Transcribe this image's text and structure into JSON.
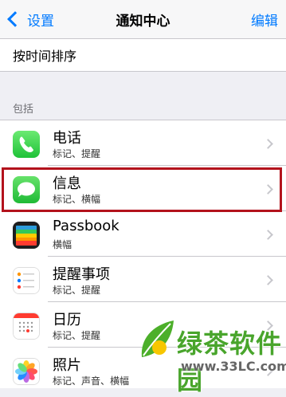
{
  "navbar": {
    "back_label": "设置",
    "title": "通知中心",
    "edit_label": "编辑"
  },
  "sort": {
    "label": "按时间排序"
  },
  "section": {
    "header": "包括"
  },
  "apps": [
    {
      "name": "电话",
      "subtitle": "标记、提醒",
      "icon": "phone-icon",
      "color": "#4cd964"
    },
    {
      "name": "信息",
      "subtitle": "标记、横幅",
      "icon": "messages-icon",
      "color": "#34c749"
    },
    {
      "name": "Passbook",
      "subtitle": "横幅",
      "icon": "passbook-icon",
      "color": "#1d1d1f"
    },
    {
      "name": "提醒事项",
      "subtitle": "标记、提醒",
      "icon": "reminders-icon",
      "color": "#ffffff"
    },
    {
      "name": "日历",
      "subtitle": "标记、提醒",
      "icon": "calendar-icon",
      "color": "#ffffff"
    },
    {
      "name": "照片",
      "subtitle": "标记、声音、横幅",
      "icon": "photos-icon",
      "color": "#ffffff"
    }
  ],
  "colors": {
    "accent": "#007aff",
    "highlight": "#b3121c",
    "watermark": "#49a52c"
  },
  "watermark": {
    "text": "绿茶软件园",
    "url": "www.33LC.com"
  }
}
